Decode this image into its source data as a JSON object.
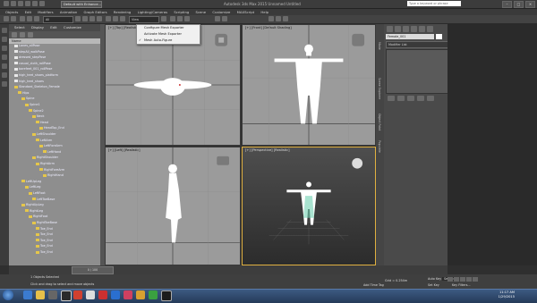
{
  "window": {
    "title": "Autodesk 3ds Max 2015   Unnamed   Untitled",
    "workspace": "Default with Enhance...",
    "search_placeholder": "Type a keyword or phrase",
    "controls": [
      "–",
      "□",
      "×"
    ]
  },
  "menus": [
    "Objects",
    "Edit",
    "Modifiers",
    "Animation",
    "Graph Editors",
    "Rendering",
    "Lighting/Cameras",
    "Scripting",
    "Scene",
    "Customize",
    "MAXScript",
    "Help"
  ],
  "toolbar": {
    "selection_filter": "All",
    "view": "View"
  },
  "scene_explorer": {
    "tabs": [
      "Select",
      "Display",
      "Edit",
      "Customize"
    ],
    "column": "Name",
    "items": [
      {
        "label": "Lanes_allPose",
        "indent": 0,
        "kind": "a"
      },
      {
        "label": "stepAll_walkPose",
        "indent": 0,
        "kind": "a"
      },
      {
        "label": "dressed_stepPose",
        "indent": 0,
        "kind": "a"
      },
      {
        "label": "casual_cloth_rollPose",
        "indent": 0,
        "kind": "a"
      },
      {
        "label": "barefeet_001_rollPose",
        "indent": 0,
        "kind": "a"
      },
      {
        "label": "high_heel_shoes_platform",
        "indent": 0,
        "kind": "a"
      },
      {
        "label": "high_heel_shoes",
        "indent": 0,
        "kind": "a"
      },
      {
        "label": "Standard_Skeleton_Female",
        "indent": 0,
        "kind": "b"
      },
      {
        "label": "Hips",
        "indent": 1,
        "kind": "b"
      },
      {
        "label": "Spine",
        "indent": 2,
        "kind": "b"
      },
      {
        "label": "Spine1",
        "indent": 3,
        "kind": "b"
      },
      {
        "label": "Spine2",
        "indent": 4,
        "kind": "b"
      },
      {
        "label": "Neck",
        "indent": 5,
        "kind": "b"
      },
      {
        "label": "Head",
        "indent": 6,
        "kind": "b"
      },
      {
        "label": "HeadTop_End",
        "indent": 7,
        "kind": "b"
      },
      {
        "label": "LeftShoulder",
        "indent": 5,
        "kind": "b"
      },
      {
        "label": "LeftArm",
        "indent": 6,
        "kind": "b"
      },
      {
        "label": "LeftForeArm",
        "indent": 7,
        "kind": "b"
      },
      {
        "label": "LeftHand",
        "indent": 8,
        "kind": "b"
      },
      {
        "label": "RightShoulder",
        "indent": 5,
        "kind": "b"
      },
      {
        "label": "RightArm",
        "indent": 6,
        "kind": "b"
      },
      {
        "label": "RightForeArm",
        "indent": 7,
        "kind": "b"
      },
      {
        "label": "RightHand",
        "indent": 8,
        "kind": "b"
      },
      {
        "label": "LeftUpLeg",
        "indent": 2,
        "kind": "b"
      },
      {
        "label": "LeftLeg",
        "indent": 3,
        "kind": "b"
      },
      {
        "label": "LeftFoot",
        "indent": 4,
        "kind": "b"
      },
      {
        "label": "LeftToeBase",
        "indent": 5,
        "kind": "b"
      },
      {
        "label": "RightUpLeg",
        "indent": 2,
        "kind": "b"
      },
      {
        "label": "RightLeg",
        "indent": 3,
        "kind": "b"
      },
      {
        "label": "RightFoot",
        "indent": 4,
        "kind": "b"
      },
      {
        "label": "RightToeBase",
        "indent": 5,
        "kind": "b"
      },
      {
        "label": "Toe_End",
        "indent": 6,
        "kind": "b"
      },
      {
        "label": "Toe_End",
        "indent": 6,
        "kind": "b"
      },
      {
        "label": "Toe_End",
        "indent": 6,
        "kind": "b"
      },
      {
        "label": "Toe_End",
        "indent": 6,
        "kind": "b"
      },
      {
        "label": "Toe_End",
        "indent": 6,
        "kind": "b"
      }
    ],
    "footer_dropdown": "Default with Enhanced..."
  },
  "viewports": {
    "top": "[+] [Top] [Realistic]",
    "front": "[+] [Front] [Default Shading]",
    "left": "[+] [Left] [Realistic]",
    "perspective": "[+] [Perspective] [Realistic]"
  },
  "dropdown_menu": {
    "items": [
      {
        "label": "Configure Mesh Exporter",
        "checked": false
      },
      {
        "label": "Activate Mesh Exporter",
        "checked": false
      },
      {
        "label": "Mesh Auto-Figure",
        "checked": true
      }
    ],
    "check_glyph": "✓"
  },
  "command_panel": {
    "object_name": "Female_001",
    "modifier_list": "Modifier List",
    "side_tabs": [
      "Mode",
      "Scene Explorer",
      "Object Paint",
      "Populate"
    ]
  },
  "timeline": {
    "slider": "0 / 100"
  },
  "track_ticks": [
    "0",
    "10",
    "20",
    "30",
    "40",
    "50",
    "60",
    "70",
    "80",
    "90",
    "100"
  ],
  "status": {
    "selection": "1 Objects Selected",
    "prompt": "Click and drag to select and move objects",
    "grid": "Grid = 0.254m",
    "autokey": "Auto Key",
    "selected": "Selected",
    "setkey": "Set Key",
    "keyfilters": "Key Filters...",
    "add_time_tag": "Add Time Tag"
  },
  "taskbar": {
    "time": "11:17 AM",
    "date": "1/29/2015"
  },
  "colors": {
    "accent": "#e0b040",
    "taskbar": "#253b59"
  }
}
